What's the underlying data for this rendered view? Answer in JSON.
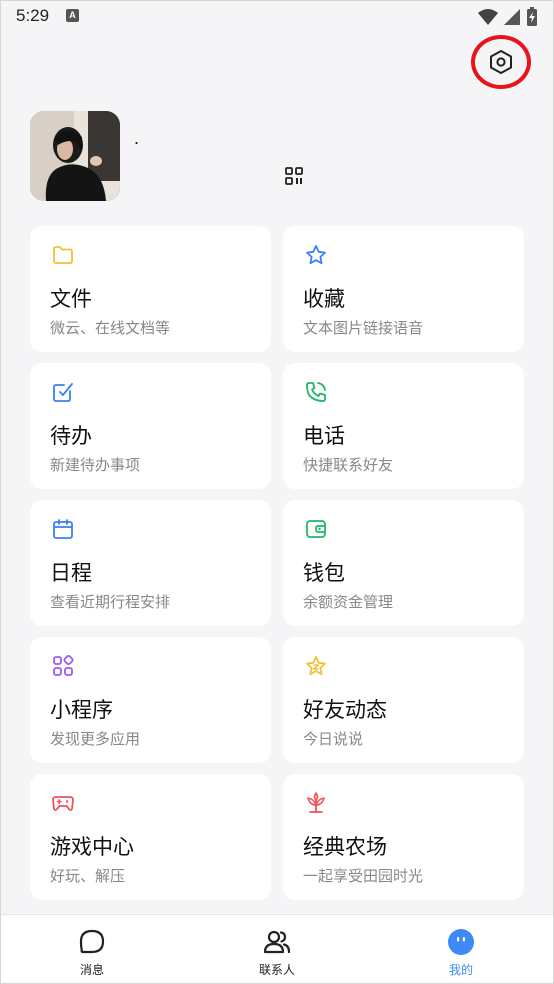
{
  "status_bar": {
    "time": "5:29",
    "notif_letter": "A"
  },
  "profile": {
    "nickname": "."
  },
  "grid": [
    {
      "title": "文件",
      "subtitle": "微云、在线文档等",
      "icon": "folder-icon",
      "color": "#f2c037"
    },
    {
      "title": "收藏",
      "subtitle": "文本图片链接语音",
      "icon": "star-icon",
      "color": "#3d7ff5"
    },
    {
      "title": "待办",
      "subtitle": "新建待办事项",
      "icon": "todo-check-icon",
      "color": "#3d7ff5"
    },
    {
      "title": "电话",
      "subtitle": "快捷联系好友",
      "icon": "phone-icon",
      "color": "#1fb86b"
    },
    {
      "title": "日程",
      "subtitle": "查看近期行程安排",
      "icon": "calendar-icon",
      "color": "#3d7ff5"
    },
    {
      "title": "钱包",
      "subtitle": "余额资金管理",
      "icon": "wallet-icon",
      "color": "#1fb86b"
    },
    {
      "title": "小程序",
      "subtitle": "发现更多应用",
      "icon": "mini-program-icon",
      "color": "#9b59f5"
    },
    {
      "title": "好友动态",
      "subtitle": "今日说说",
      "icon": "friend-feed-star-icon",
      "color": "#f2c037"
    },
    {
      "title": "游戏中心",
      "subtitle": "好玩、解压",
      "icon": "gamepad-icon",
      "color": "#f0515a"
    },
    {
      "title": "经典农场",
      "subtitle": "一起享受田园时光",
      "icon": "farm-plant-icon",
      "color": "#f0515a"
    }
  ],
  "bottom_nav": [
    {
      "label": "消息",
      "icon": "message-bubble-icon"
    },
    {
      "label": "联系人",
      "icon": "contacts-icon"
    },
    {
      "label": "我的",
      "icon": "me-face-icon",
      "active": true
    }
  ],
  "accent": "#3d8af7",
  "highlight": "#e8141b"
}
